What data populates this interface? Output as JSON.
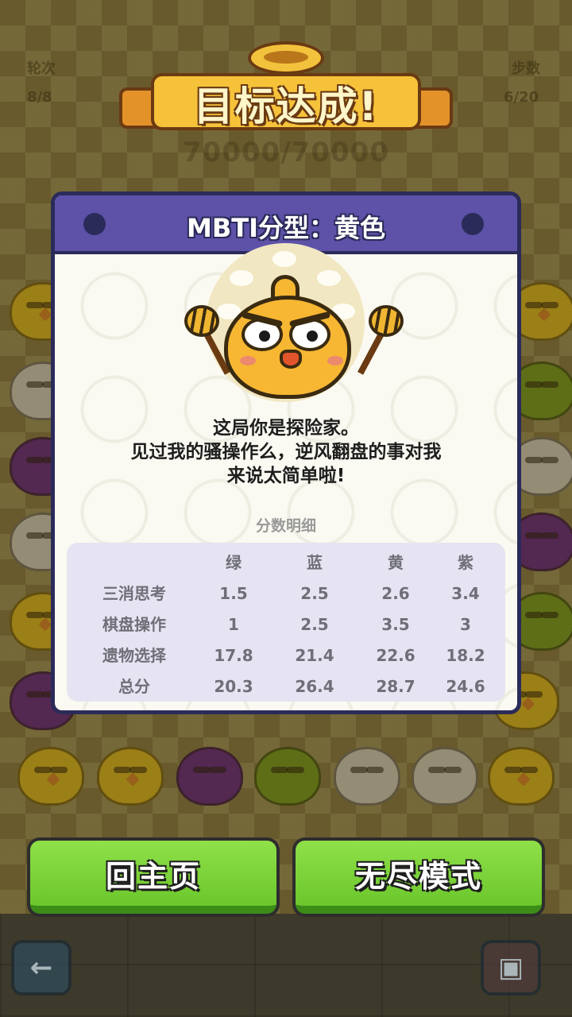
{
  "hud": {
    "round_label": "轮次",
    "round_value": "8/8",
    "steps_label": "步数",
    "steps_value": "6/20",
    "score": "70000/70000"
  },
  "banner": {
    "title": "目标达成!"
  },
  "result_card": {
    "title": "MBTI分型：黄色",
    "description_lines": [
      "这局你是探险家。",
      "见过我的骚操作么，逆风翻盘的事对我",
      "来说太简单啦!"
    ],
    "section_label": "分数明细",
    "table": {
      "headers": [
        "",
        "绿",
        "蓝",
        "黄",
        "紫"
      ],
      "rows": [
        [
          "三消思考",
          "1.5",
          "2.5",
          "2.6",
          "3.4"
        ],
        [
          "棋盘操作",
          "1",
          "2.5",
          "3.5",
          "3"
        ],
        [
          "遗物选择",
          "17.8",
          "21.4",
          "22.6",
          "18.2"
        ],
        [
          "总分",
          "20.3",
          "26.4",
          "28.7",
          "24.6"
        ]
      ]
    }
  },
  "buttons": {
    "home": "回主页",
    "endless": "无尽模式"
  },
  "icons": {
    "back": "arrow-left-icon",
    "book": "book-icon"
  },
  "colors": {
    "card_header": "#5d52a8",
    "button_green": "#6bc72c",
    "mascot_yellow": "#f7b733"
  }
}
